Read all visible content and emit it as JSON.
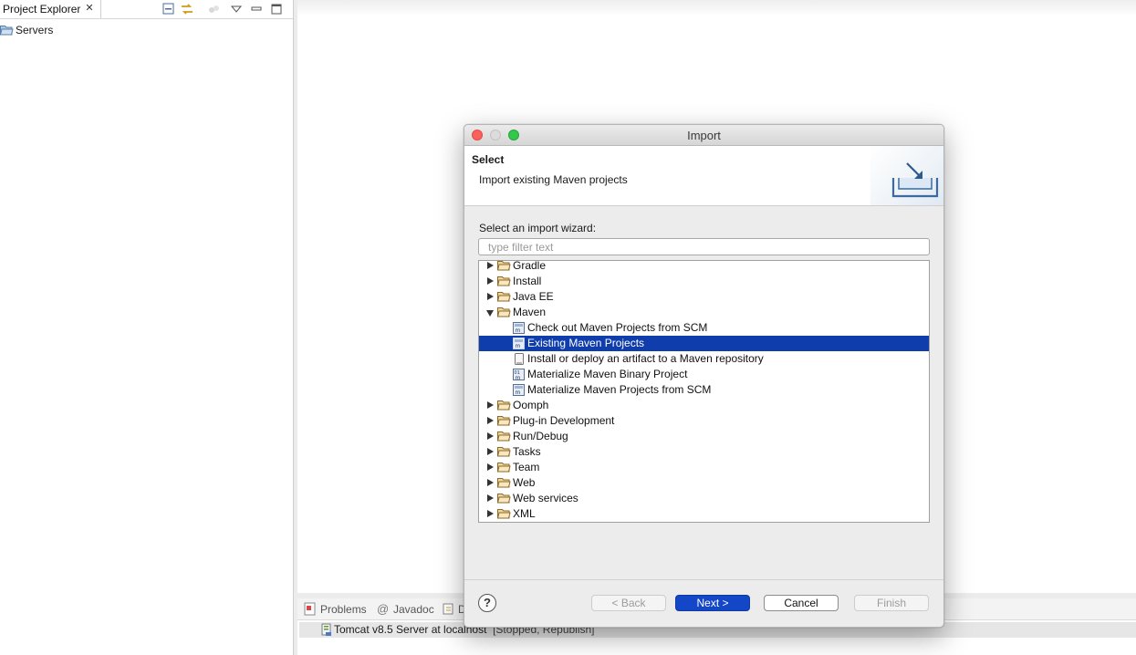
{
  "explorer": {
    "tab_label": "Project Explorer",
    "close_glyph": "✕",
    "items": [
      {
        "label": "Servers",
        "icon": "folder-icon"
      }
    ]
  },
  "bottom_panel": {
    "tabs": [
      {
        "label": "Problems",
        "icon": "problems-icon"
      },
      {
        "label": "Javadoc",
        "icon": "at-icon"
      },
      {
        "label": "D",
        "icon": "declaration-icon"
      }
    ],
    "server_row": {
      "name": "Tomcat v8.5 Server at localhost",
      "status": "[Stopped, Republish]"
    }
  },
  "dialog": {
    "title": "Import",
    "header": {
      "title": "Select",
      "description": "Import existing Maven projects"
    },
    "wizard_label": "Select an import wizard:",
    "filter_placeholder": "type filter text",
    "tree": [
      {
        "label": "Gradle",
        "level": 0,
        "expanded": false,
        "icon": "folder-icon"
      },
      {
        "label": "Install",
        "level": 0,
        "expanded": false,
        "icon": "folder-icon"
      },
      {
        "label": "Java EE",
        "level": 0,
        "expanded": false,
        "icon": "folder-icon"
      },
      {
        "label": "Maven",
        "level": 0,
        "expanded": true,
        "icon": "folder-open-icon"
      },
      {
        "label": "Check out Maven Projects from SCM",
        "level": 1,
        "icon": "maven-icon"
      },
      {
        "label": "Existing Maven Projects",
        "level": 1,
        "icon": "maven-icon",
        "selected": true
      },
      {
        "label": "Install or deploy an artifact to a Maven repository",
        "level": 1,
        "icon": "jar-icon"
      },
      {
        "label": "Materialize Maven Binary Project",
        "level": 1,
        "icon": "maven-icon"
      },
      {
        "label": "Materialize Maven Projects from SCM",
        "level": 1,
        "icon": "maven-icon"
      },
      {
        "label": "Oomph",
        "level": 0,
        "expanded": false,
        "icon": "folder-icon"
      },
      {
        "label": "Plug-in Development",
        "level": 0,
        "expanded": false,
        "icon": "folder-icon"
      },
      {
        "label": "Run/Debug",
        "level": 0,
        "expanded": false,
        "icon": "folder-icon"
      },
      {
        "label": "Tasks",
        "level": 0,
        "expanded": false,
        "icon": "folder-icon"
      },
      {
        "label": "Team",
        "level": 0,
        "expanded": false,
        "icon": "folder-icon"
      },
      {
        "label": "Web",
        "level": 0,
        "expanded": false,
        "icon": "folder-icon"
      },
      {
        "label": "Web services",
        "level": 0,
        "expanded": false,
        "icon": "folder-icon"
      },
      {
        "label": "XML",
        "level": 0,
        "expanded": false,
        "icon": "folder-icon"
      }
    ],
    "buttons": {
      "help": "?",
      "back": "< Back",
      "next": "Next >",
      "cancel": "Cancel",
      "finish": "Finish"
    }
  },
  "colors": {
    "selection": "#0f3dab",
    "default_button": "#1446c8",
    "close_light": "#fc605c",
    "zoom_light": "#34c84a"
  }
}
